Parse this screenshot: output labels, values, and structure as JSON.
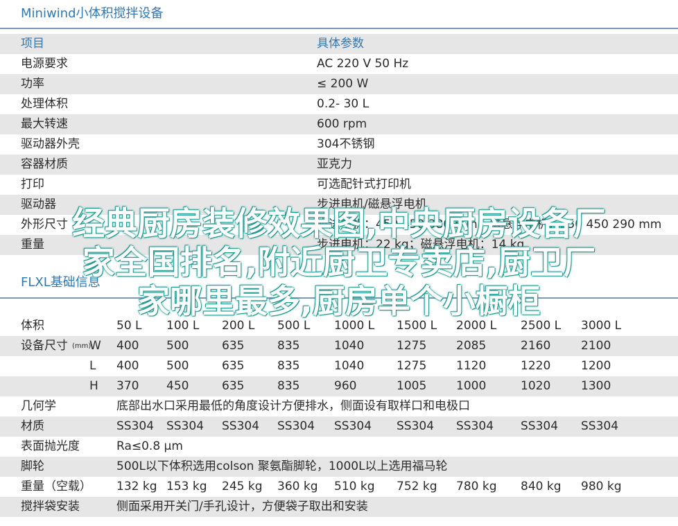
{
  "section1": {
    "title": "Miniwind小体积搅拌设备",
    "header": {
      "item": "项目",
      "value": "具体参数"
    },
    "rows": [
      {
        "label": "电源要求",
        "value": "AC 220  V 50 Hz"
      },
      {
        "label": "功率",
        "value": "≤ 200 W"
      },
      {
        "label": "处理体积",
        "value": "0.2-  30 L"
      },
      {
        "label": "最大转速",
        "value": "600  rpm"
      },
      {
        "label": "驱动器外壳",
        "value": "304不锈钢"
      },
      {
        "label": "容器材质",
        "value": "亚克力"
      },
      {
        "label": "打印",
        "value": "可选配针式打印机"
      },
      {
        "label": "驱动器",
        "value": "步进电机/磁悬浮电机"
      },
      {
        "label": "外形尺寸",
        "value": "步进电机：450 450 380 mm；磁悬浮电机：550 450 290 mm"
      },
      {
        "label": "重量",
        "value": "步进电机：22 kg；磁悬浮电机：14 kg"
      }
    ]
  },
  "section2": {
    "title": "FLXL基础信息",
    "volume": {
      "label": "体积",
      "values": [
        "50 L",
        "100 L",
        "200 L",
        "500 L",
        "1000 L",
        "1500 L",
        "2000 L",
        "2500 L",
        "3000 L"
      ]
    },
    "dimensions": {
      "label": "设备尺寸",
      "unit": "(mm)",
      "rows": [
        {
          "axis": "W",
          "values": [
            "400",
            "500",
            "635",
            "835",
            "1040",
            "1275",
            "2085",
            "2160",
            "2100"
          ]
        },
        {
          "axis": "L",
          "values": [
            "400",
            "500",
            "635",
            "835",
            "1040",
            "1275",
            "1120",
            "1220",
            "1200"
          ]
        },
        {
          "axis": "H",
          "values": [
            "370",
            "450",
            "635",
            "835",
            "960",
            "1005",
            "1000",
            "1020",
            "1300"
          ]
        }
      ]
    },
    "geometry": {
      "label": "几何学",
      "value": "底部出水口采用最低的角度设计方便排水，侧面设有取样口和电极口"
    },
    "material": {
      "label": "材质",
      "values": [
        "SS304",
        "SS304",
        "SS304",
        "SS304",
        "SS304",
        "SS304",
        "SS304",
        "SS304",
        "SS304"
      ]
    },
    "polish": {
      "label": "表面抛光度",
      "value": "Ra≤0.8 µm"
    },
    "wheels": {
      "label": "脚轮",
      "value": "500L以下体积选用colson 聚氨酯脚轮，1000L以上选用福马轮"
    },
    "weight": {
      "label": "重量（空载）",
      "values": [
        "132 kg",
        "153 kg",
        "245 kg",
        "360 kg",
        "510 kg",
        "752 kg",
        "780 kg",
        "840 kg",
        "980 kg"
      ]
    },
    "bag": {
      "label": "搅拌袋安装",
      "value": "侧面采用开关门/手孔设计，方便袋子取出和安装"
    }
  },
  "overlay": {
    "line1": "经典厨房装修效果图,中央厨房设备厂",
    "line2": "家全国排名,附近厨卫专卖店,厨卫厂",
    "line3": "家哪里最多,厨房单个小橱柜"
  }
}
